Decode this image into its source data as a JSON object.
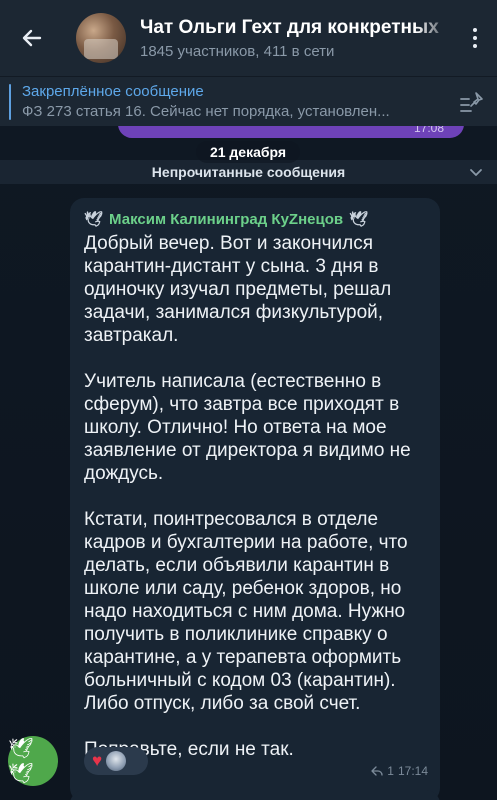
{
  "header": {
    "chat_title": "Чат Ольги Гехт для конкретных",
    "subtitle": "1845 участников, 411 в сети"
  },
  "pinned": {
    "title": "Закреплённое сообщение",
    "text": "ФЗ 273 статья 16. Сейчас нет порядка, установлен..."
  },
  "previous_message": {
    "time": "17:08"
  },
  "date_separator": "21 декабря",
  "unread_label": "Непрочитанные сообщения",
  "message": {
    "sender": "Максим Калининград КуZнецов",
    "text": "Добрый вечер. Вот и закончился\nкарантин-дистант у сына. 3 дня в\nодиночку изучал предметы, решал\nзадачи, занимался физкультурой,\nзавтракал.\n\nУчитель написала (естественно в\nсферум), что завтра все приходят в\nшколу. Отлично! Но ответа на мое\nзаявление от директора я видимо не\nдождусь.\n\nКстати, поинтресовался в отделе\nкадров и бухгалтерии на работе, что\nделать, если объявили карантин в\nшколе или саду, ребенок здоров, но\nнадо находиться с ним дома. Нужно\nполучить в поликлинике справку о\nкарантине, а у терапевта оформить\nбольничный с кодом 03 (карантин).\nЛибо отпуск, либо за свой счет.\n\nПоправьте, если не так.",
    "reaction_count": "",
    "replies": "1",
    "time": "17:14"
  },
  "colors": {
    "header_bg": "#1c2733",
    "chat_bg": "#0e1621",
    "bubble_bg": "#182533",
    "sender_name": "#6cd08a",
    "pinned_accent": "#5ea8ea",
    "own_bubble": "#6e42b8",
    "heart": "#e8344a"
  },
  "icons": {
    "back": "arrow-left-icon",
    "menu": "more-vertical-icon",
    "pinned": "pin-list-icon",
    "chevron": "chevron-down-icon",
    "reaction": "heart-icon",
    "reply": "reply-icon",
    "dove": "dove-emoji-icon"
  }
}
